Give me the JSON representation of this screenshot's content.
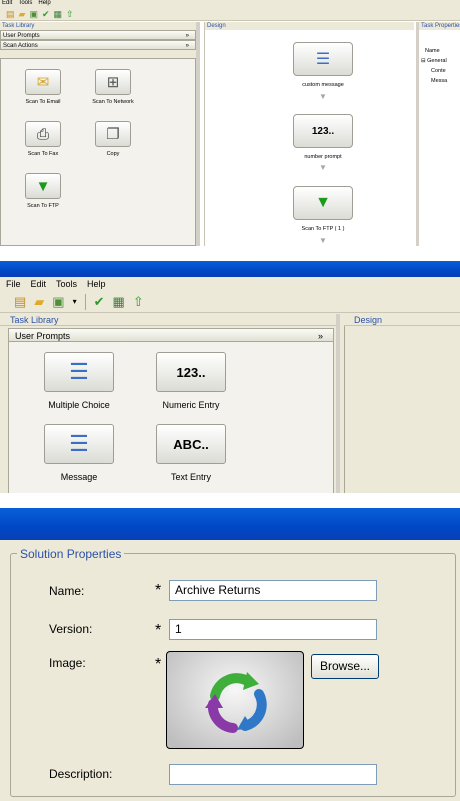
{
  "panel1": {
    "menu": [
      "Edit",
      "Tools",
      "Help"
    ],
    "toolbar_icons": [
      "new-icon",
      "open-icon",
      "save-icon",
      "check-icon",
      "image-icon",
      "up-arrow-icon"
    ],
    "task_library_title": "Task Library",
    "group_user_prompts": "User Prompts",
    "group_scan_actions": "Scan Actions",
    "collapse_glyph": "»",
    "tiles": [
      {
        "label": "Scan To Email",
        "icon": "✉"
      },
      {
        "label": "Scan To Network",
        "icon": "⊞"
      },
      {
        "label": "Scan To Fax",
        "icon": "⎙"
      },
      {
        "label": "Copy",
        "icon": "❐"
      },
      {
        "label": "Scan To FTP",
        "icon": "▼"
      }
    ],
    "design_title": "Design",
    "flow": [
      {
        "label": "custom message",
        "icon": "☰"
      },
      {
        "label": "number prompt",
        "icon": "123.."
      },
      {
        "label": "Scan To FTP ( 1 )",
        "icon": "▼"
      }
    ],
    "props_title": "Task Properties",
    "props_rows": [
      "Name",
      "⊟ General",
      "Conte",
      "Messa"
    ]
  },
  "panel2": {
    "menu": [
      "File",
      "Edit",
      "Tools",
      "Help"
    ],
    "task_library_title": "Task Library",
    "group_user_prompts": "User Prompts",
    "collapse_glyph": "»",
    "tiles": [
      {
        "label": "Multiple Choice",
        "icon": "☰"
      },
      {
        "label": "Numeric Entry",
        "icon": "123.."
      },
      {
        "label": "Message",
        "icon": "☰"
      },
      {
        "label": "Text Entry",
        "icon": "ABC.."
      }
    ],
    "design_title": "Design"
  },
  "panel3": {
    "section_title": "Solution Properties",
    "name_label": "Name:",
    "name_value": "Archive Returns",
    "version_label": "Version:",
    "version_value": "1",
    "image_label": "Image:",
    "description_label": "Description:",
    "description_value": "",
    "required_mark": "*",
    "browse_label": "Browse..."
  }
}
